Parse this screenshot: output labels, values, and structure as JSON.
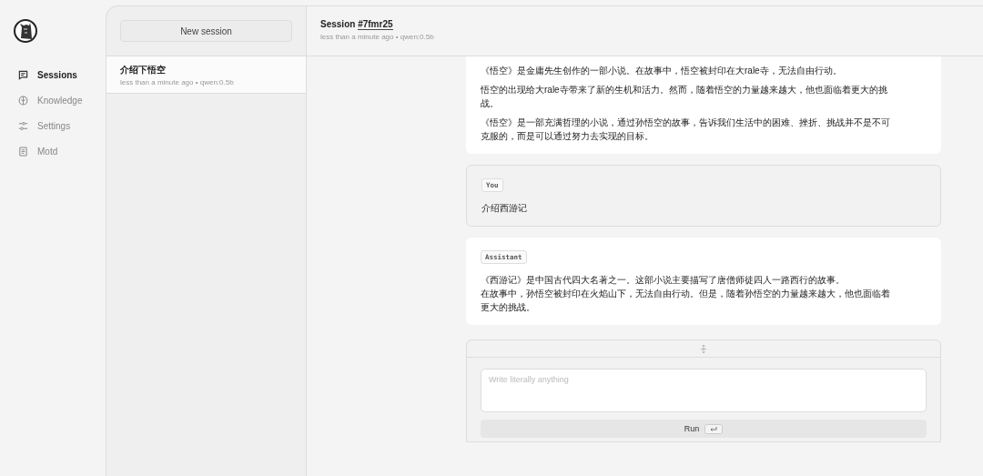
{
  "nav": {
    "items": [
      {
        "label": "Sessions",
        "selected": true
      },
      {
        "label": "Knowledge",
        "selected": false
      },
      {
        "label": "Settings",
        "selected": false
      },
      {
        "label": "Motd",
        "selected": false
      }
    ]
  },
  "sessions": {
    "new_button": "New session",
    "items": [
      {
        "title": "介绍下悟空",
        "meta": "less than a minute ago • qwen:0.5b",
        "selected": true
      }
    ]
  },
  "header": {
    "title": "Session ",
    "session_id": "#7fmr25",
    "meta": "less than a minute ago • qwen:0.5b"
  },
  "messages": [
    {
      "kind": "assistant",
      "paragraphs": [
        [
          "《悟空》是金庸先生创作的一部小说。在故事中，悟空被封印在大rale寺，无法自由行动。"
        ],
        [
          "悟空的出现给大rale寺带来了新的生机和活力。然而，随着悟空的力量越来越大，他也面临着更大的挑战。"
        ],
        [
          "《悟空》是一部充满哲理的小说，通过孙悟空的故事，告诉我们生活中的困难、挫折、挑战并不是不可克服的，而是可以通过努力去实现的目标。"
        ]
      ]
    },
    {
      "kind": "user",
      "role": "You",
      "paragraphs": [
        [
          "介绍西游记"
        ]
      ]
    },
    {
      "kind": "assistant",
      "role": "Assistant",
      "paragraphs": [
        [
          "《西游记》是中国古代四大名著之一。这部小说主要描写了唐僧师徒四人一路西行的故事。",
          "在故事中，孙悟空被封印在火焰山下，无法自由行动。但是，随着孙悟空的力量越来越大，他也面临着更大的挑战。"
        ]
      ]
    }
  ],
  "composer": {
    "placeholder": "Write literally anything",
    "run_button": "Run"
  }
}
